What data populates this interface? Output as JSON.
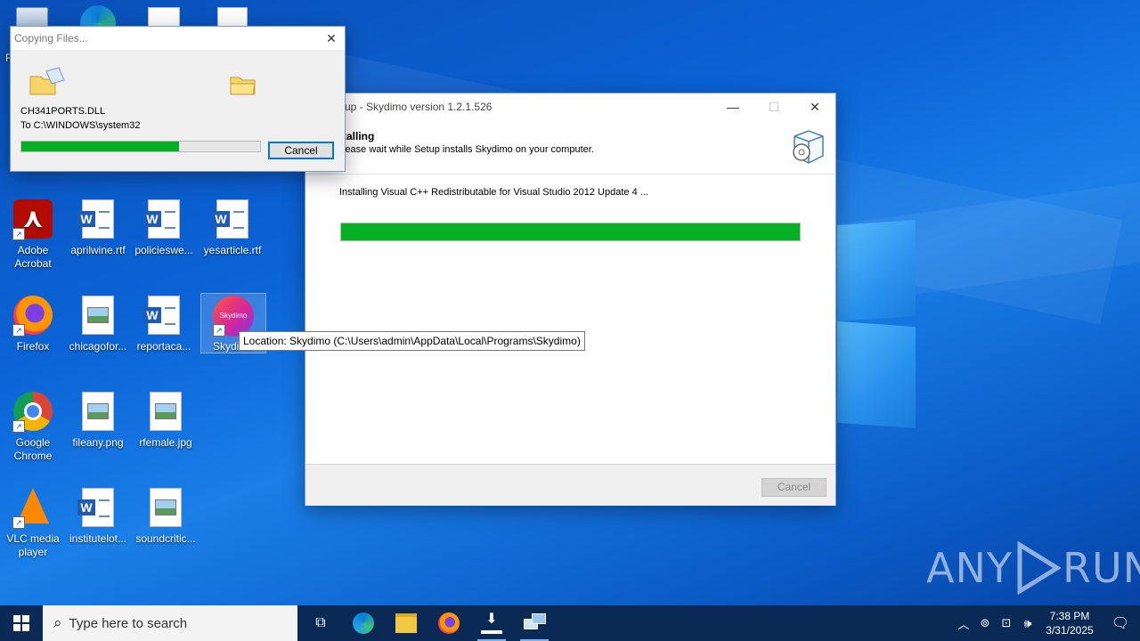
{
  "desktop": {
    "icons": [
      {
        "label": "Adobe\nAcrobat"
      },
      {
        "label": "aprilwine.rtf"
      },
      {
        "label": "policieswe..."
      },
      {
        "label": "yesarticle.rtf"
      },
      {
        "label": "Firefox"
      },
      {
        "label": "chicagofor..."
      },
      {
        "label": "reportaca..."
      },
      {
        "label": "Skydimo"
      },
      {
        "label": "Google\nChrome"
      },
      {
        "label": "fileany.png"
      },
      {
        "label": "rfemale.jpg"
      },
      {
        "label": "VLC media\nplayer"
      },
      {
        "label": "institutelot..."
      },
      {
        "label": "soundcritic..."
      }
    ],
    "top_left_fragment": "R",
    "skydimo_badge": "Skydimo"
  },
  "copy_dialog": {
    "title": "Copying Files...",
    "filename": "CH341PORTS.DLL",
    "destination": "To C:\\WINDOWS\\system32",
    "progress": 0.66,
    "cancel_label": "Cancel"
  },
  "setup_window": {
    "title": "up - Skydimo version 1.2.1.526",
    "heading": "talling",
    "subheading": "lease wait while Setup installs Skydimo on your computer.",
    "status": "Installing Visual C++ Redistributable for Visual Studio 2012 Update 4 ...",
    "progress": 1.0,
    "cancel_label": "Cancel"
  },
  "tooltip": {
    "text": "Location: Skydimo (C:\\Users\\admin\\AppData\\Local\\Programs\\Skydimo)"
  },
  "taskbar": {
    "search_placeholder": "Type here to search",
    "time": "7:38 PM",
    "date": "3/31/2025"
  },
  "watermark": {
    "text_left": "ANY",
    "text_right": "RUN"
  },
  "colors": {
    "progress_green": "#06b025",
    "accent": "#0078d7"
  }
}
